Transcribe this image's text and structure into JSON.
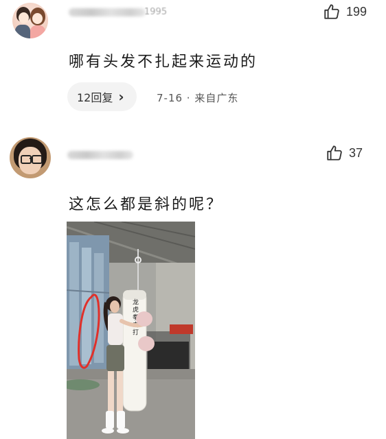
{
  "comments": [
    {
      "username_visible_tail": "1995",
      "likes": "199",
      "text": "哪有头发不扎起来运动的",
      "reply_button": {
        "count_label": "12回复",
        "chevron": "›"
      },
      "meta": "7-16 · 来自广东"
    },
    {
      "likes": "37",
      "text": "这怎么都是斜的呢？",
      "photo": {
        "bag_text": "龙虎拳击打"
      }
    }
  ],
  "icons": {
    "like": "thumbs-up-icon",
    "chevron": "chevron-right-icon"
  },
  "colors": {
    "background": "#ffffff",
    "text": "#1b1b1b",
    "meta": "#555555",
    "reply_pill_bg": "#f3f3f3",
    "annotation_circle": "#e0302a"
  }
}
